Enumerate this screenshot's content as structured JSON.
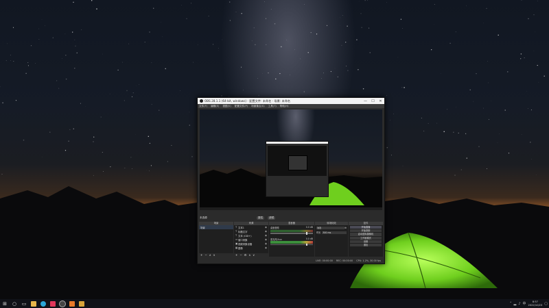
{
  "window": {
    "title": "OBS 28.1.1 (64-bit, windows) - 配置文件: 未命名 - 场景: 未命名",
    "minimize": "—",
    "maximize": "☐",
    "close": "✕"
  },
  "menu": [
    "文件(F)",
    "编辑(E)",
    "视图(V)",
    "配置文件(P)",
    "场景集合(S)",
    "工具(T)",
    "帮助(H)"
  ],
  "status_row": {
    "scene_label": "未选源",
    "chip1": "属性",
    "chip2": "滤镜"
  },
  "docks": {
    "scenes": {
      "title": "场景",
      "items": [
        "场景"
      ]
    },
    "sources": {
      "title": "来源",
      "items": [
        {
          "icon": "T",
          "name": "文本1"
        },
        {
          "icon": "T",
          "name": "标题文字"
        },
        {
          "icon": "T",
          "name": "文本 (GDI+)"
        },
        {
          "icon": "▭",
          "name": "窗口采集"
        },
        {
          "icon": "▣",
          "name": "视频采集设备"
        },
        {
          "icon": "▦",
          "name": "图像"
        }
      ]
    },
    "mixer": {
      "title": "混音器",
      "tracks": [
        {
          "name": "桌面音频",
          "level": "0.0 dB"
        },
        {
          "name": "麦克风/Aux",
          "level": "0.0 dB"
        }
      ]
    },
    "transitions": {
      "title": "转场特效",
      "type": "淡出",
      "duration_label": "时长",
      "duration": "300 ms"
    },
    "controls": {
      "title": "控件",
      "buttons": [
        "开始直播",
        "开始录制",
        "启动虚拟摄像机",
        "工作室模式",
        "设置",
        "退出"
      ]
    }
  },
  "bottom_status": {
    "live": "LIVE: 00:00:00",
    "rec": "REC: 00:00:00",
    "cpu": "CPU: 1.2%, 30.00 fps"
  },
  "taskbar": {
    "time": "8:57",
    "date": "2022/10/23"
  },
  "colors": {
    "accent": "#3c8f3c",
    "obs_bg": "#2b2b2b",
    "tent": "#7ed321"
  }
}
